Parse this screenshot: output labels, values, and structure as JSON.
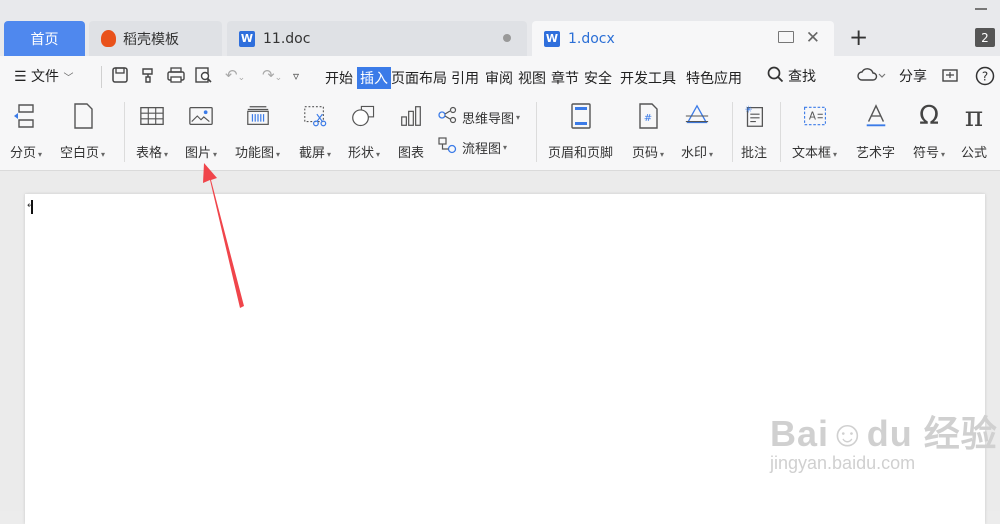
{
  "tabs": {
    "home": "首页",
    "tab1": "稻壳模板",
    "tab2": "11.doc",
    "tab3": "1.docx",
    "badge": "2"
  },
  "menu": {
    "file": "文件",
    "items": [
      "开始",
      "插入",
      "页面布局",
      "引用",
      "审阅",
      "视图",
      "章节",
      "安全",
      "开发工具",
      "特色应用"
    ],
    "search": "查找",
    "share": "分享"
  },
  "ribbon": {
    "page_break": "分页",
    "blank_page": "空白页",
    "table": "表格",
    "picture": "图片",
    "function_chart": "功能图",
    "screenshot": "截屏",
    "shape": "形状",
    "chart": "图表",
    "mind_map": "思维导图",
    "flowchart": "流程图",
    "header_footer": "页眉和页脚",
    "page_number": "页码",
    "watermark": "水印",
    "comment": "批注",
    "textbox": "文本框",
    "word_art": "艺术字",
    "symbol": "符号",
    "formula": "公式"
  },
  "document": {
    "paragraph_mark": "↵"
  },
  "watermark": {
    "brand": "Bai☺du 经验",
    "url": "jingyan.baidu.com"
  },
  "colors": {
    "accent": "#3b7be8",
    "arrow": "#f0454b",
    "home_tab": "#4f88ee"
  }
}
